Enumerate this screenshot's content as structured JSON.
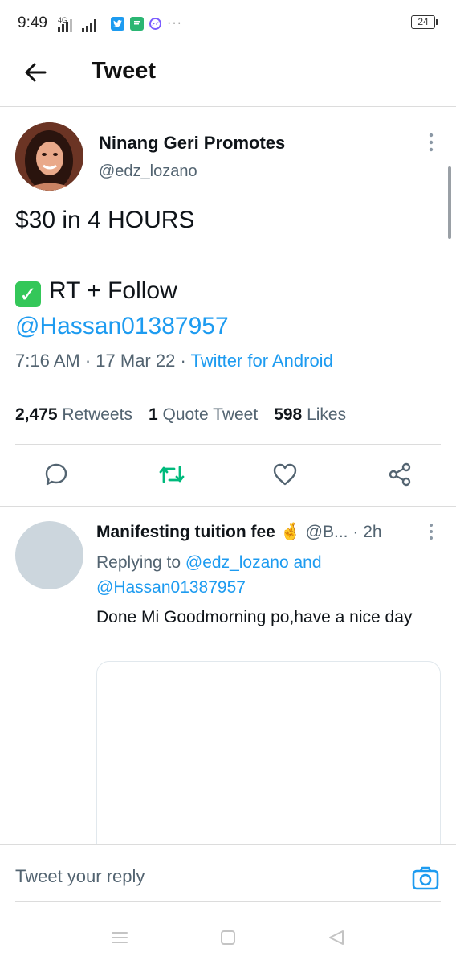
{
  "status_bar": {
    "time": "9:49",
    "network": "4G",
    "battery": "24",
    "notification_icons": [
      "twitter-icon",
      "messaging-app-icon",
      "messenger-icon"
    ],
    "more": "···"
  },
  "header": {
    "title": "Tweet",
    "back_icon": "arrow-left-icon"
  },
  "tweet": {
    "author_name": "Ninang Geri Promotes",
    "author_handle": "@edz_lozano",
    "lines": [
      "$30 in 4 HOURS",
      "",
      "RT + Follow"
    ],
    "check_emoji": "✓",
    "mention": "@Hassan01387957",
    "time": "7:16 AM",
    "date": "17 Mar 22",
    "source": "Twitter for Android",
    "stats": {
      "retweets_count": "2,475",
      "retweets_label": "Retweets",
      "quotes_count": "1",
      "quotes_label": "Quote Tweet",
      "likes_count": "598",
      "likes_label": "Likes"
    }
  },
  "actions": [
    "reply-icon",
    "retweet-icon",
    "like-icon",
    "share-icon"
  ],
  "reply": {
    "name": "Manifesting tuition fee",
    "emoji": "🤞",
    "handle": "@B...",
    "time": "2h",
    "replying_prefix": "Replying to",
    "replying_user1": "@edz_lozano",
    "replying_and": "and",
    "replying_user2": "@Hassan01387957",
    "text": "Done Mi Goodmorning po,have a nice day"
  },
  "composer": {
    "placeholder": "Tweet your reply",
    "camera_icon": "camera-icon"
  },
  "nav": [
    "menu-icon",
    "home-square-icon",
    "back-triangle-icon"
  ],
  "colors": {
    "accent": "#1d9bf0",
    "retweet_active": "#00ba7c",
    "muted": "#536471"
  }
}
